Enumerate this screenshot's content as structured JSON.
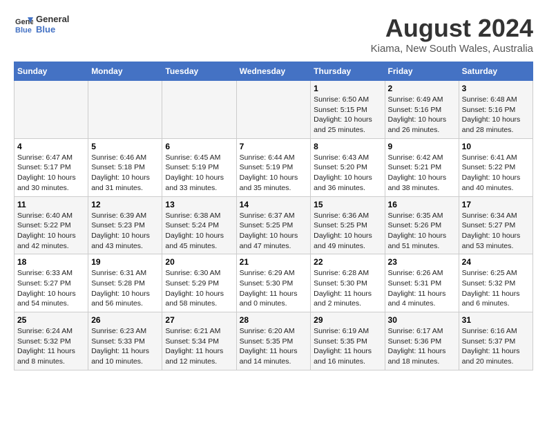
{
  "logo": {
    "line1": "General",
    "line2": "Blue"
  },
  "title": "August 2024",
  "subtitle": "Kiama, New South Wales, Australia",
  "days_of_week": [
    "Sunday",
    "Monday",
    "Tuesday",
    "Wednesday",
    "Thursday",
    "Friday",
    "Saturday"
  ],
  "weeks": [
    [
      {
        "day": "",
        "info": ""
      },
      {
        "day": "",
        "info": ""
      },
      {
        "day": "",
        "info": ""
      },
      {
        "day": "",
        "info": ""
      },
      {
        "day": "1",
        "info": "Sunrise: 6:50 AM\nSunset: 5:15 PM\nDaylight: 10 hours\nand 25 minutes."
      },
      {
        "day": "2",
        "info": "Sunrise: 6:49 AM\nSunset: 5:16 PM\nDaylight: 10 hours\nand 26 minutes."
      },
      {
        "day": "3",
        "info": "Sunrise: 6:48 AM\nSunset: 5:16 PM\nDaylight: 10 hours\nand 28 minutes."
      }
    ],
    [
      {
        "day": "4",
        "info": "Sunrise: 6:47 AM\nSunset: 5:17 PM\nDaylight: 10 hours\nand 30 minutes."
      },
      {
        "day": "5",
        "info": "Sunrise: 6:46 AM\nSunset: 5:18 PM\nDaylight: 10 hours\nand 31 minutes."
      },
      {
        "day": "6",
        "info": "Sunrise: 6:45 AM\nSunset: 5:19 PM\nDaylight: 10 hours\nand 33 minutes."
      },
      {
        "day": "7",
        "info": "Sunrise: 6:44 AM\nSunset: 5:19 PM\nDaylight: 10 hours\nand 35 minutes."
      },
      {
        "day": "8",
        "info": "Sunrise: 6:43 AM\nSunset: 5:20 PM\nDaylight: 10 hours\nand 36 minutes."
      },
      {
        "day": "9",
        "info": "Sunrise: 6:42 AM\nSunset: 5:21 PM\nDaylight: 10 hours\nand 38 minutes."
      },
      {
        "day": "10",
        "info": "Sunrise: 6:41 AM\nSunset: 5:22 PM\nDaylight: 10 hours\nand 40 minutes."
      }
    ],
    [
      {
        "day": "11",
        "info": "Sunrise: 6:40 AM\nSunset: 5:22 PM\nDaylight: 10 hours\nand 42 minutes."
      },
      {
        "day": "12",
        "info": "Sunrise: 6:39 AM\nSunset: 5:23 PM\nDaylight: 10 hours\nand 43 minutes."
      },
      {
        "day": "13",
        "info": "Sunrise: 6:38 AM\nSunset: 5:24 PM\nDaylight: 10 hours\nand 45 minutes."
      },
      {
        "day": "14",
        "info": "Sunrise: 6:37 AM\nSunset: 5:25 PM\nDaylight: 10 hours\nand 47 minutes."
      },
      {
        "day": "15",
        "info": "Sunrise: 6:36 AM\nSunset: 5:25 PM\nDaylight: 10 hours\nand 49 minutes."
      },
      {
        "day": "16",
        "info": "Sunrise: 6:35 AM\nSunset: 5:26 PM\nDaylight: 10 hours\nand 51 minutes."
      },
      {
        "day": "17",
        "info": "Sunrise: 6:34 AM\nSunset: 5:27 PM\nDaylight: 10 hours\nand 53 minutes."
      }
    ],
    [
      {
        "day": "18",
        "info": "Sunrise: 6:33 AM\nSunset: 5:27 PM\nDaylight: 10 hours\nand 54 minutes."
      },
      {
        "day": "19",
        "info": "Sunrise: 6:31 AM\nSunset: 5:28 PM\nDaylight: 10 hours\nand 56 minutes."
      },
      {
        "day": "20",
        "info": "Sunrise: 6:30 AM\nSunset: 5:29 PM\nDaylight: 10 hours\nand 58 minutes."
      },
      {
        "day": "21",
        "info": "Sunrise: 6:29 AM\nSunset: 5:30 PM\nDaylight: 11 hours\nand 0 minutes."
      },
      {
        "day": "22",
        "info": "Sunrise: 6:28 AM\nSunset: 5:30 PM\nDaylight: 11 hours\nand 2 minutes."
      },
      {
        "day": "23",
        "info": "Sunrise: 6:26 AM\nSunset: 5:31 PM\nDaylight: 11 hours\nand 4 minutes."
      },
      {
        "day": "24",
        "info": "Sunrise: 6:25 AM\nSunset: 5:32 PM\nDaylight: 11 hours\nand 6 minutes."
      }
    ],
    [
      {
        "day": "25",
        "info": "Sunrise: 6:24 AM\nSunset: 5:32 PM\nDaylight: 11 hours\nand 8 minutes."
      },
      {
        "day": "26",
        "info": "Sunrise: 6:23 AM\nSunset: 5:33 PM\nDaylight: 11 hours\nand 10 minutes."
      },
      {
        "day": "27",
        "info": "Sunrise: 6:21 AM\nSunset: 5:34 PM\nDaylight: 11 hours\nand 12 minutes."
      },
      {
        "day": "28",
        "info": "Sunrise: 6:20 AM\nSunset: 5:35 PM\nDaylight: 11 hours\nand 14 minutes."
      },
      {
        "day": "29",
        "info": "Sunrise: 6:19 AM\nSunset: 5:35 PM\nDaylight: 11 hours\nand 16 minutes."
      },
      {
        "day": "30",
        "info": "Sunrise: 6:17 AM\nSunset: 5:36 PM\nDaylight: 11 hours\nand 18 minutes."
      },
      {
        "day": "31",
        "info": "Sunrise: 6:16 AM\nSunset: 5:37 PM\nDaylight: 11 hours\nand 20 minutes."
      }
    ]
  ]
}
